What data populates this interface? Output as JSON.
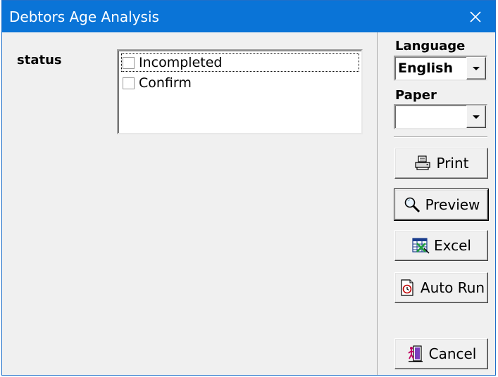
{
  "window": {
    "title": "Debtors Age Analysis"
  },
  "status": {
    "label": "status",
    "options": [
      {
        "label": "Incompleted",
        "checked": false
      },
      {
        "label": "Confirm",
        "checked": false
      }
    ]
  },
  "language": {
    "label": "Language",
    "value": "English"
  },
  "paper": {
    "label": "Paper",
    "value": ""
  },
  "buttons": {
    "print": "Print",
    "preview": "Preview",
    "excel": "Excel",
    "auto_run": "Auto Run",
    "cancel": "Cancel"
  },
  "colors": {
    "titlebar": "#0a74d7",
    "background": "#f0f0f0"
  }
}
